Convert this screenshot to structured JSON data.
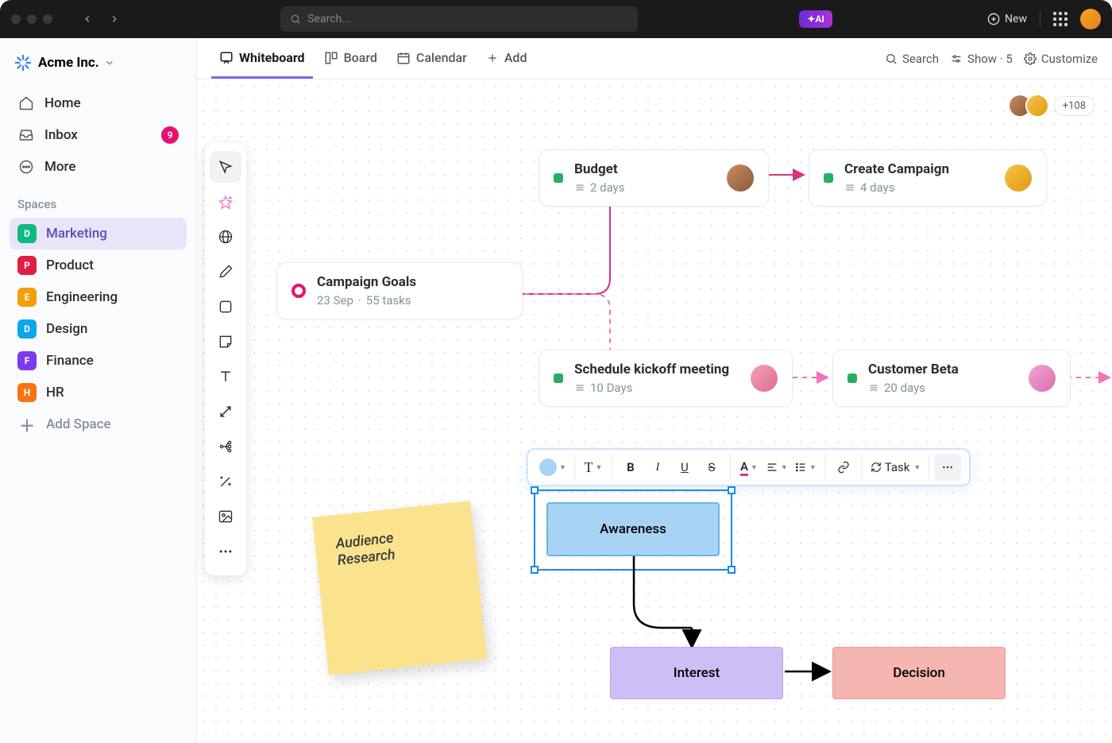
{
  "titlebar": {
    "search_placeholder": "Search...",
    "ai_label": "AI",
    "new_label": "New"
  },
  "sidebar": {
    "workspace": "Acme Inc.",
    "nav": [
      {
        "label": "Home"
      },
      {
        "label": "Inbox",
        "badge": "9"
      },
      {
        "label": "More"
      }
    ],
    "spaces_label": "Spaces",
    "spaces": [
      {
        "initial": "D",
        "label": "Marketing",
        "color": "#10b981"
      },
      {
        "initial": "P",
        "label": "Product",
        "color": "#e11d48"
      },
      {
        "initial": "E",
        "label": "Engineering",
        "color": "#f59e0b"
      },
      {
        "initial": "D",
        "label": "Design",
        "color": "#0ea5e9"
      },
      {
        "initial": "F",
        "label": "Finance",
        "color": "#7c3aed"
      },
      {
        "initial": "H",
        "label": "HR",
        "color": "#f97316"
      }
    ],
    "add_space": "Add Space"
  },
  "viewbar": {
    "tabs": [
      {
        "label": "Whiteboard"
      },
      {
        "label": "Board"
      },
      {
        "label": "Calendar"
      },
      {
        "label": "Add"
      }
    ],
    "search": "Search",
    "show": "Show · 5",
    "customize": "Customize"
  },
  "presence": {
    "overflow": "+108"
  },
  "cards": {
    "goals": {
      "title": "Campaign Goals",
      "date": "23 Sep",
      "tasks": "55 tasks"
    },
    "budget": {
      "title": "Budget",
      "meta": "2 days"
    },
    "create": {
      "title": "Create Campaign",
      "meta": "4 days"
    },
    "kickoff": {
      "title": "Schedule kickoff meeting",
      "meta": "10 Days"
    },
    "beta": {
      "title": "Customer Beta",
      "meta": "20 days"
    }
  },
  "sticky": {
    "text": "Audience Research"
  },
  "shapes": {
    "awareness": "Awareness",
    "interest": "Interest",
    "decision": "Decision"
  },
  "format_toolbar": {
    "task_label": "Task"
  },
  "avatars": {
    "a1": "linear-gradient(135deg,#c98b5e,#8a5a3c)",
    "a2": "linear-gradient(135deg,#f6c34a,#e09a12)",
    "a3": "linear-gradient(135deg,#f2a0b8,#e06c8f)",
    "a4": "linear-gradient(135deg,#c98b5e,#8a5a3c)",
    "a5": "linear-gradient(135deg,#f6c34a,#e09a12)",
    "a6": "linear-gradient(135deg,#f2a0b8,#e06c8f)"
  }
}
